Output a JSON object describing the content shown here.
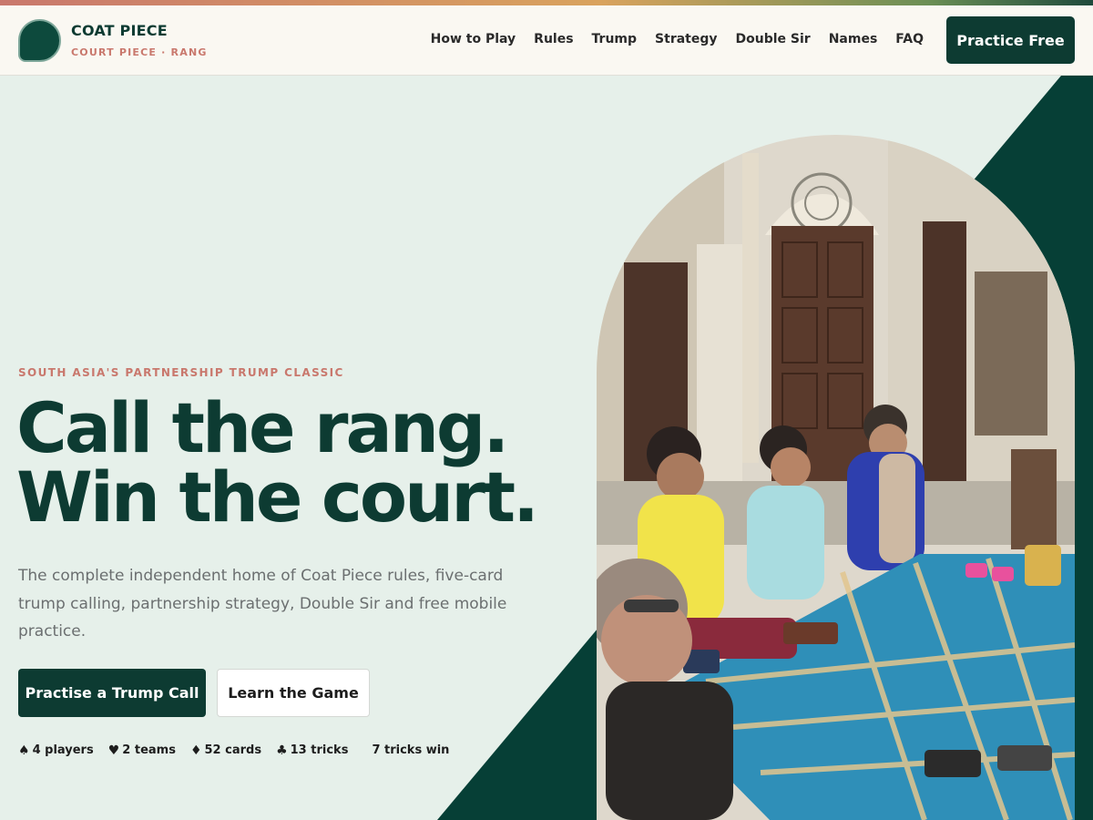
{
  "brand": {
    "name": "COAT PIECE",
    "subtitle": "COURT PIECE · RANG"
  },
  "nav": {
    "items": [
      {
        "label": "How to Play"
      },
      {
        "label": "Rules"
      },
      {
        "label": "Trump"
      },
      {
        "label": "Strategy"
      },
      {
        "label": "Double Sir"
      },
      {
        "label": "Names"
      },
      {
        "label": "FAQ"
      }
    ],
    "cta": "Practice Free"
  },
  "hero": {
    "eyebrow": "SOUTH ASIA'S PARTNERSHIP TRUMP CLASSIC",
    "headline_line1": "Call the rang.",
    "headline_line2": "Win the court.",
    "lead": "The complete independent home of Coat Piece rules, five-card trump calling, partnership strategy, Double Sir and free mobile practice.",
    "primary_button": "Practise a Trump Call",
    "secondary_button": "Learn the Game",
    "stats": [
      {
        "icon": "spade-icon",
        "glyph": "♠",
        "label": "4 players"
      },
      {
        "icon": "heart-icon",
        "glyph": "♥",
        "label": "2 teams"
      },
      {
        "icon": "diamond-icon",
        "glyph": "♦",
        "label": "52 cards"
      },
      {
        "icon": "club-icon",
        "glyph": "♣",
        "label": "13 tricks"
      },
      {
        "label": "7 tricks win"
      }
    ]
  },
  "colors": {
    "brand_dark": "#0d3b32",
    "accent_rose": "#c9786d",
    "hero_bg": "#e6f0ea",
    "header_bg": "#faf8f2"
  }
}
